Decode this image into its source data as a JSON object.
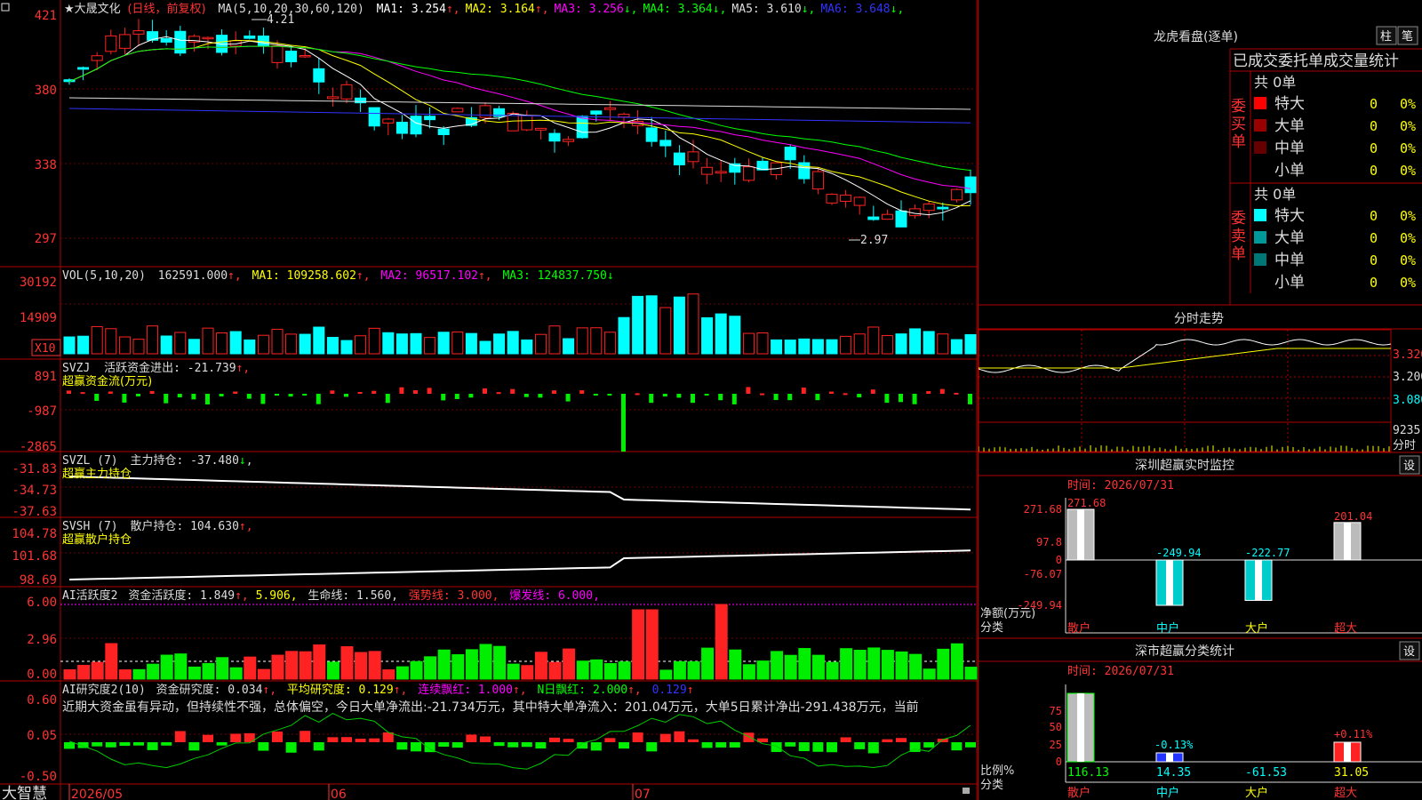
{
  "stock": {
    "title_prefix": "★大晟文化",
    "title_mode": "(日线，前复权)",
    "ma_params": "MA(5,10,20,30,60,120)",
    "ma": [
      {
        "label": "MA1:",
        "value": "3.254",
        "arrow": "↑",
        "color": "#ffffff"
      },
      {
        "label": "MA2:",
        "value": "3.164",
        "arrow": "↑",
        "color": "#ffff00"
      },
      {
        "label": "MA3:",
        "value": "3.256",
        "arrow": "↓",
        "color": "#ff00ff"
      },
      {
        "label": "MA4:",
        "value": "3.364",
        "arrow": "↓",
        "color": "#00ff00"
      },
      {
        "label": "MA5:",
        "value": "3.610",
        "arrow": "↓",
        "color": "#dddddd"
      },
      {
        "label": "MA6:",
        "value": "3.648",
        "arrow": "↓",
        "color": "#3333ff"
      }
    ],
    "high_label": "4.21",
    "low_label": "2.97"
  },
  "price_axis": [
    "421",
    "380",
    "338",
    "297"
  ],
  "vol": {
    "text": "VOL(5,10,20)",
    "value": "162591.000",
    "ma1": "MA1: 109258.602",
    "ma2": "MA2: 96517.102",
    "ma3": "MA3: 124837.750",
    "axis": [
      "30192",
      "14909"
    ],
    "unit": "X10"
  },
  "svzj": {
    "name": "SVZJ",
    "label": "活跃资金进出: -21.739",
    "sub": "超赢资金流(万元)",
    "axis": [
      "891",
      "-987",
      "-2865"
    ]
  },
  "svzl": {
    "name": "SVZL (7)",
    "label": "主力持仓: -37.480",
    "sub": "超赢主力持仓",
    "axis": [
      "-31.83",
      "-34.73",
      "-37.63"
    ]
  },
  "svsh": {
    "name": "SVSH (7)",
    "label": "散户持仓: 104.630",
    "sub": "超赢散户持仓",
    "axis": [
      "104.78",
      "101.68",
      "98.69"
    ]
  },
  "ai1": {
    "name": "AI活跃度2",
    "label": "资金活跃度: 1.849",
    "v2": "5.906,",
    "life": "生命线: 1.560,",
    "strong": "强势线: 3.000,",
    "burst": "爆发线: 6.000,",
    "axis": [
      "6.00",
      "2.96",
      "0.00"
    ]
  },
  "ai2": {
    "name": "AI研究度2(10)",
    "label": "资金研究度: 0.034",
    "avg": "平均研究度: 0.129",
    "red": "连续飘红: 1.000",
    "nred": "N日飘红: 2.000",
    "last": "0.129",
    "axis": [
      "0.60",
      "0.05",
      "-0.50"
    ],
    "comment": "近期大资金虽有异动，但持续性不强，总体偏空，今日大单净流出:-21.734万元，其中特大单净流入：201.04万元，大单5日累计净出-291.438万元，当前"
  },
  "bottom": {
    "brand": "大智慧",
    "dates": [
      "2026/05",
      "06",
      "07"
    ]
  },
  "right": {
    "dragon": "龙虎看盘(逐单)",
    "btn1": "柱",
    "btn2": "笔",
    "stats_title": "已成交委托单成交量统计",
    "buy": {
      "side": "委买单",
      "total": "共 0单",
      "rows": [
        {
          "n": "特大",
          "v": "0",
          "p": "0%",
          "c": "#ff0000"
        },
        {
          "n": "大单",
          "v": "0",
          "p": "0%",
          "c": "#990000"
        },
        {
          "n": "中单",
          "v": "0",
          "p": "0%",
          "c": "#660000"
        },
        {
          "n": "小单",
          "v": "0",
          "p": "0%",
          "c": ""
        }
      ]
    },
    "sell": {
      "side": "委卖单",
      "total": "共 0单",
      "rows": [
        {
          "n": "特大",
          "v": "0",
          "p": "0%",
          "c": "#00ffff"
        },
        {
          "n": "大单",
          "v": "0",
          "p": "0%",
          "c": "#009999"
        },
        {
          "n": "中单",
          "v": "0",
          "p": "0%",
          "c": "#007777"
        },
        {
          "n": "小单",
          "v": "0",
          "p": "0%",
          "c": ""
        }
      ]
    },
    "fenshi": {
      "title": "分时走势",
      "axis": [
        "3.320",
        "3.200",
        "3.080",
        "9235"
      ],
      "fen": "分时"
    },
    "sz": {
      "title": "深圳超赢实时监控",
      "set": "设",
      "time": "时间: 2026/07/31",
      "axis": [
        "271.68",
        "97.8",
        "0",
        "-76.07",
        "-249.94"
      ],
      "values": [
        "271.68",
        "-249.94",
        "-222.77",
        "201.04"
      ],
      "ylabel": "净额(万元)",
      "xlabel": "分类",
      "cats": [
        "散户",
        "中户",
        "大户",
        "超大"
      ]
    },
    "ss": {
      "title": "深市超赢分类统计",
      "set": "设",
      "time": "时间: 2026/07/31",
      "axis": [
        "75",
        "50",
        "25",
        "0"
      ],
      "pct": [
        "-0.13%",
        "+0.11%"
      ],
      "values": [
        "116.13",
        "14.35",
        "-61.53",
        "31.05"
      ],
      "ylabel": "比例%",
      "xlabel": "分类",
      "cats": [
        "散户",
        "中户",
        "大户",
        "超大"
      ]
    }
  }
}
